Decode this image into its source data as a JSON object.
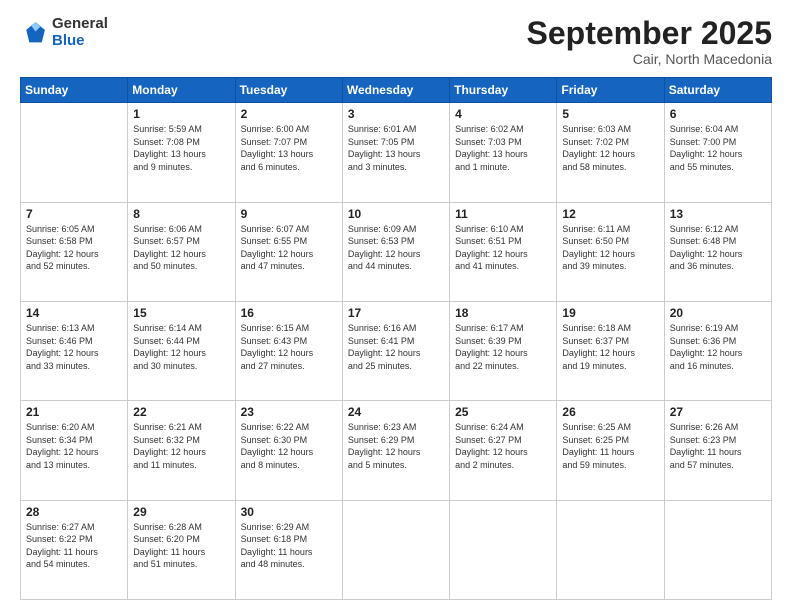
{
  "logo": {
    "general": "General",
    "blue": "Blue"
  },
  "header": {
    "month": "September 2025",
    "location": "Cair, North Macedonia"
  },
  "weekdays": [
    "Sunday",
    "Monday",
    "Tuesday",
    "Wednesday",
    "Thursday",
    "Friday",
    "Saturday"
  ],
  "days": [
    {
      "date": "",
      "info": ""
    },
    {
      "date": "1",
      "info": "Sunrise: 5:59 AM\nSunset: 7:08 PM\nDaylight: 13 hours\nand 9 minutes."
    },
    {
      "date": "2",
      "info": "Sunrise: 6:00 AM\nSunset: 7:07 PM\nDaylight: 13 hours\nand 6 minutes."
    },
    {
      "date": "3",
      "info": "Sunrise: 6:01 AM\nSunset: 7:05 PM\nDaylight: 13 hours\nand 3 minutes."
    },
    {
      "date": "4",
      "info": "Sunrise: 6:02 AM\nSunset: 7:03 PM\nDaylight: 13 hours\nand 1 minute."
    },
    {
      "date": "5",
      "info": "Sunrise: 6:03 AM\nSunset: 7:02 PM\nDaylight: 12 hours\nand 58 minutes."
    },
    {
      "date": "6",
      "info": "Sunrise: 6:04 AM\nSunset: 7:00 PM\nDaylight: 12 hours\nand 55 minutes."
    },
    {
      "date": "7",
      "info": "Sunrise: 6:05 AM\nSunset: 6:58 PM\nDaylight: 12 hours\nand 52 minutes."
    },
    {
      "date": "8",
      "info": "Sunrise: 6:06 AM\nSunset: 6:57 PM\nDaylight: 12 hours\nand 50 minutes."
    },
    {
      "date": "9",
      "info": "Sunrise: 6:07 AM\nSunset: 6:55 PM\nDaylight: 12 hours\nand 47 minutes."
    },
    {
      "date": "10",
      "info": "Sunrise: 6:09 AM\nSunset: 6:53 PM\nDaylight: 12 hours\nand 44 minutes."
    },
    {
      "date": "11",
      "info": "Sunrise: 6:10 AM\nSunset: 6:51 PM\nDaylight: 12 hours\nand 41 minutes."
    },
    {
      "date": "12",
      "info": "Sunrise: 6:11 AM\nSunset: 6:50 PM\nDaylight: 12 hours\nand 39 minutes."
    },
    {
      "date": "13",
      "info": "Sunrise: 6:12 AM\nSunset: 6:48 PM\nDaylight: 12 hours\nand 36 minutes."
    },
    {
      "date": "14",
      "info": "Sunrise: 6:13 AM\nSunset: 6:46 PM\nDaylight: 12 hours\nand 33 minutes."
    },
    {
      "date": "15",
      "info": "Sunrise: 6:14 AM\nSunset: 6:44 PM\nDaylight: 12 hours\nand 30 minutes."
    },
    {
      "date": "16",
      "info": "Sunrise: 6:15 AM\nSunset: 6:43 PM\nDaylight: 12 hours\nand 27 minutes."
    },
    {
      "date": "17",
      "info": "Sunrise: 6:16 AM\nSunset: 6:41 PM\nDaylight: 12 hours\nand 25 minutes."
    },
    {
      "date": "18",
      "info": "Sunrise: 6:17 AM\nSunset: 6:39 PM\nDaylight: 12 hours\nand 22 minutes."
    },
    {
      "date": "19",
      "info": "Sunrise: 6:18 AM\nSunset: 6:37 PM\nDaylight: 12 hours\nand 19 minutes."
    },
    {
      "date": "20",
      "info": "Sunrise: 6:19 AM\nSunset: 6:36 PM\nDaylight: 12 hours\nand 16 minutes."
    },
    {
      "date": "21",
      "info": "Sunrise: 6:20 AM\nSunset: 6:34 PM\nDaylight: 12 hours\nand 13 minutes."
    },
    {
      "date": "22",
      "info": "Sunrise: 6:21 AM\nSunset: 6:32 PM\nDaylight: 12 hours\nand 11 minutes."
    },
    {
      "date": "23",
      "info": "Sunrise: 6:22 AM\nSunset: 6:30 PM\nDaylight: 12 hours\nand 8 minutes."
    },
    {
      "date": "24",
      "info": "Sunrise: 6:23 AM\nSunset: 6:29 PM\nDaylight: 12 hours\nand 5 minutes."
    },
    {
      "date": "25",
      "info": "Sunrise: 6:24 AM\nSunset: 6:27 PM\nDaylight: 12 hours\nand 2 minutes."
    },
    {
      "date": "26",
      "info": "Sunrise: 6:25 AM\nSunset: 6:25 PM\nDaylight: 11 hours\nand 59 minutes."
    },
    {
      "date": "27",
      "info": "Sunrise: 6:26 AM\nSunset: 6:23 PM\nDaylight: 11 hours\nand 57 minutes."
    },
    {
      "date": "28",
      "info": "Sunrise: 6:27 AM\nSunset: 6:22 PM\nDaylight: 11 hours\nand 54 minutes."
    },
    {
      "date": "29",
      "info": "Sunrise: 6:28 AM\nSunset: 6:20 PM\nDaylight: 11 hours\nand 51 minutes."
    },
    {
      "date": "30",
      "info": "Sunrise: 6:29 AM\nSunset: 6:18 PM\nDaylight: 11 hours\nand 48 minutes."
    },
    {
      "date": "",
      "info": ""
    },
    {
      "date": "",
      "info": ""
    },
    {
      "date": "",
      "info": ""
    },
    {
      "date": "",
      "info": ""
    }
  ]
}
